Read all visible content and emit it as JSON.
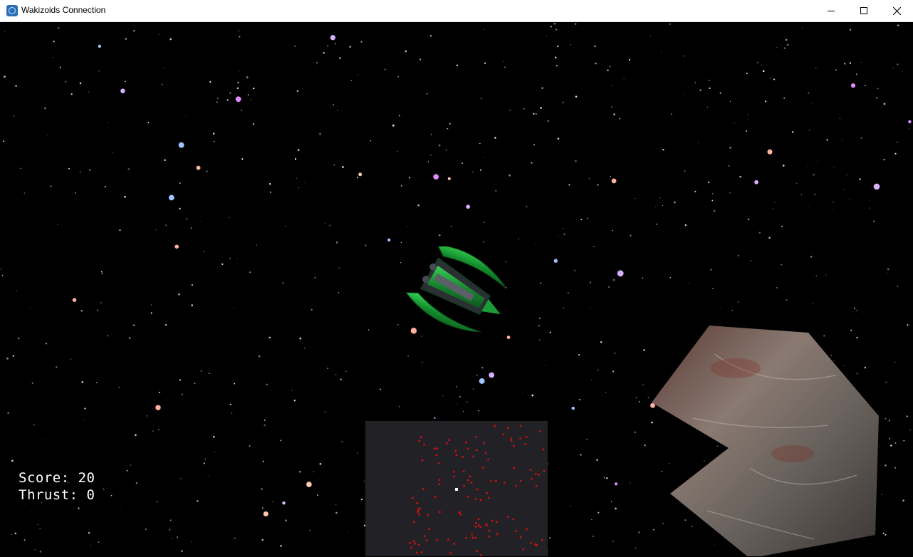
{
  "window": {
    "title": "Wakizoids Connection",
    "controls": {
      "minimize": "minimize-icon",
      "maximize": "maximize-icon",
      "close": "close-icon"
    }
  },
  "hud": {
    "score_label": "Score:",
    "score_value": "20",
    "thrust_label": "Thrust:",
    "thrust_value": "0"
  },
  "colors": {
    "space": "#000000",
    "minimap_bg": "#222226",
    "minimap_enemy": "#d01010",
    "minimap_player": "#ffffff",
    "ship_hull": "#1fa83a",
    "hud_text": "#ffffff"
  }
}
